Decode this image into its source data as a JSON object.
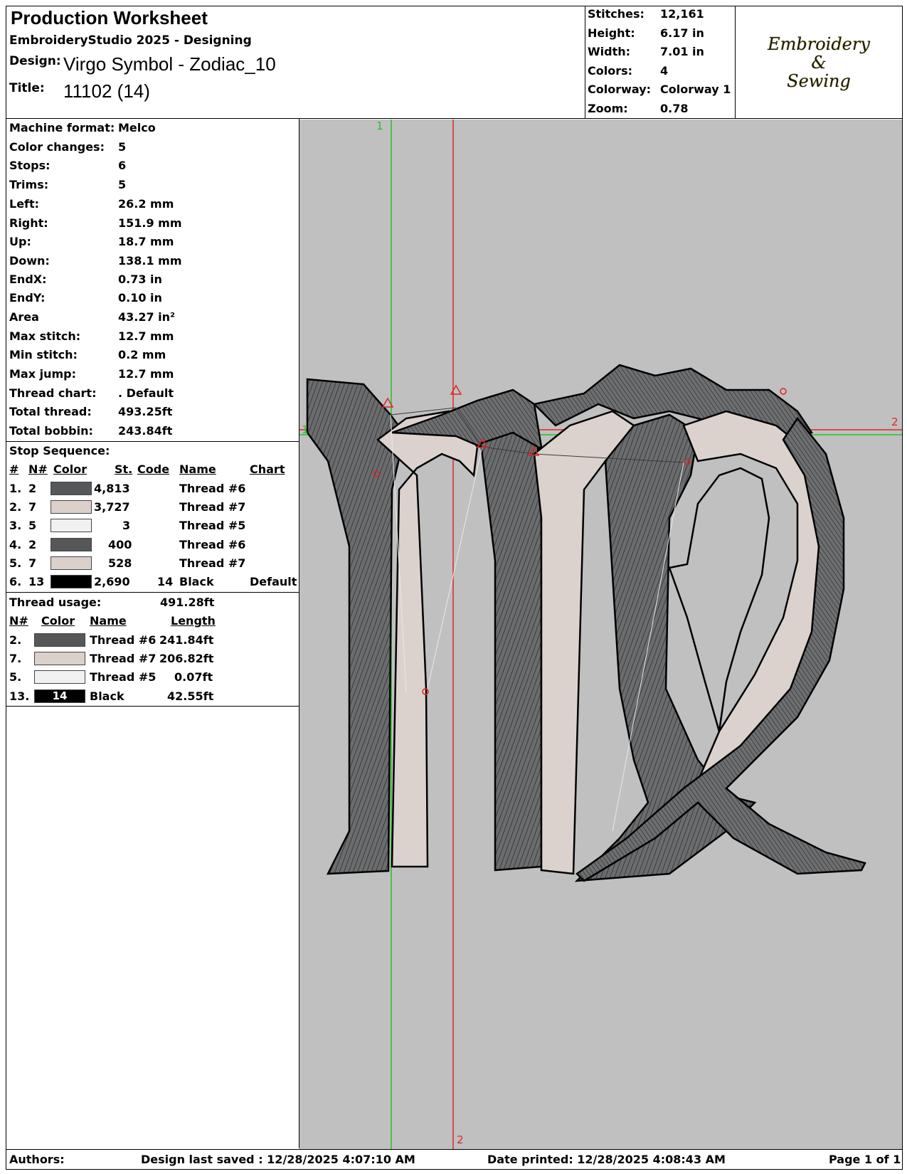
{
  "header": {
    "title": "Production Worksheet",
    "software": "EmbroideryStudio 2025 - Designing",
    "design_label": "Design:",
    "design_value": "Virgo Symbol - Zodiac_10",
    "title_label": "Title:",
    "title_value": "11102 (14)"
  },
  "summary": [
    {
      "label": "Stitches:",
      "value": "12,161"
    },
    {
      "label": "Height:",
      "value": "6.17 in"
    },
    {
      "label": "Width:",
      "value": "7.01 in"
    },
    {
      "label": "Colors:",
      "value": "4"
    },
    {
      "label": "Colorway:",
      "value": "Colorway 1"
    },
    {
      "label": "Zoom:",
      "value": "0.78"
    }
  ],
  "logo": {
    "line1": "Embroidery",
    "line2": "&",
    "line3": "Sewing"
  },
  "info": [
    {
      "label": "Machine format:",
      "value": "Melco"
    },
    {
      "label": "Color changes:",
      "value": "5"
    },
    {
      "label": "Stops:",
      "value": "6"
    },
    {
      "label": "Trims:",
      "value": "5"
    },
    {
      "label": "Left:",
      "value": "26.2 mm"
    },
    {
      "label": "Right:",
      "value": "151.9 mm"
    },
    {
      "label": "Up:",
      "value": "18.7 mm"
    },
    {
      "label": "Down:",
      "value": "138.1 mm"
    },
    {
      "label": "EndX:",
      "value": "0.73 in"
    },
    {
      "label": "EndY:",
      "value": "0.10 in"
    },
    {
      "label": "Area",
      "value": " 43.27 in²"
    },
    {
      "label": "Max stitch:",
      "value": "12.7 mm"
    },
    {
      "label": "Min stitch:",
      "value": "0.2 mm"
    },
    {
      "label": "Max jump:",
      "value": "12.7 mm"
    },
    {
      "label": "Thread chart:",
      "value": ". Default"
    },
    {
      "label": "Total thread:",
      "value": "493.25ft"
    },
    {
      "label": "Total bobbin:",
      "value": "243.84ft"
    }
  ],
  "stop_sequence": {
    "heading": "Stop Sequence:",
    "columns": [
      "#",
      "N#",
      "Color",
      "St.",
      "Code",
      "Name",
      "Chart"
    ],
    "rows": [
      {
        "num": "1.",
        "n": "2",
        "color": "#555759",
        "st": "4,813",
        "code": "",
        "name": "Thread #6",
        "chart": ""
      },
      {
        "num": "2.",
        "n": "7",
        "color": "#dcd0cb",
        "st": "3,727",
        "code": "",
        "name": "Thread #7",
        "chart": ""
      },
      {
        "num": "3.",
        "n": "5",
        "color": "#f1f1f1",
        "st": "3",
        "code": "",
        "name": "Thread #5",
        "chart": ""
      },
      {
        "num": "4.",
        "n": "2",
        "color": "#555759",
        "st": "400",
        "code": "",
        "name": "Thread #6",
        "chart": ""
      },
      {
        "num": "5.",
        "n": "7",
        "color": "#dcd0cb",
        "st": "528",
        "code": "",
        "name": "Thread #7",
        "chart": ""
      },
      {
        "num": "6.",
        "n": "13",
        "color": "#000000",
        "st": "2,690",
        "code": "14",
        "name": "Black",
        "chart": "Default"
      }
    ]
  },
  "thread_usage": {
    "heading": "Thread usage:",
    "total": "491.28ft",
    "columns": [
      "N#",
      "Color",
      "Name",
      "Length"
    ],
    "rows": [
      {
        "n": "2.",
        "color": "#555759",
        "swatch_text": "",
        "name": "Thread #6",
        "length": "241.84ft"
      },
      {
        "n": "7.",
        "color": "#dcd0cb",
        "swatch_text": "",
        "name": "Thread #7",
        "length": "206.82ft"
      },
      {
        "n": "5.",
        "color": "#f1f1f1",
        "swatch_text": "",
        "name": "Thread #5",
        "length": "0.07ft"
      },
      {
        "n": "13.",
        "color": "#000000",
        "swatch_text": "14",
        "name": "Black",
        "length": "42.55ft"
      }
    ]
  },
  "canvas": {
    "background": "#c0c0c0",
    "guide_labels": [
      "1",
      "2",
      "1",
      "2"
    ]
  },
  "footer": {
    "authors": "Authors:",
    "saved": "Design last saved : 12/28/2025 4:07:10 AM",
    "printed": "Date printed: 12/28/2025 4:08:43 AM",
    "page": "Page 1 of 1"
  }
}
